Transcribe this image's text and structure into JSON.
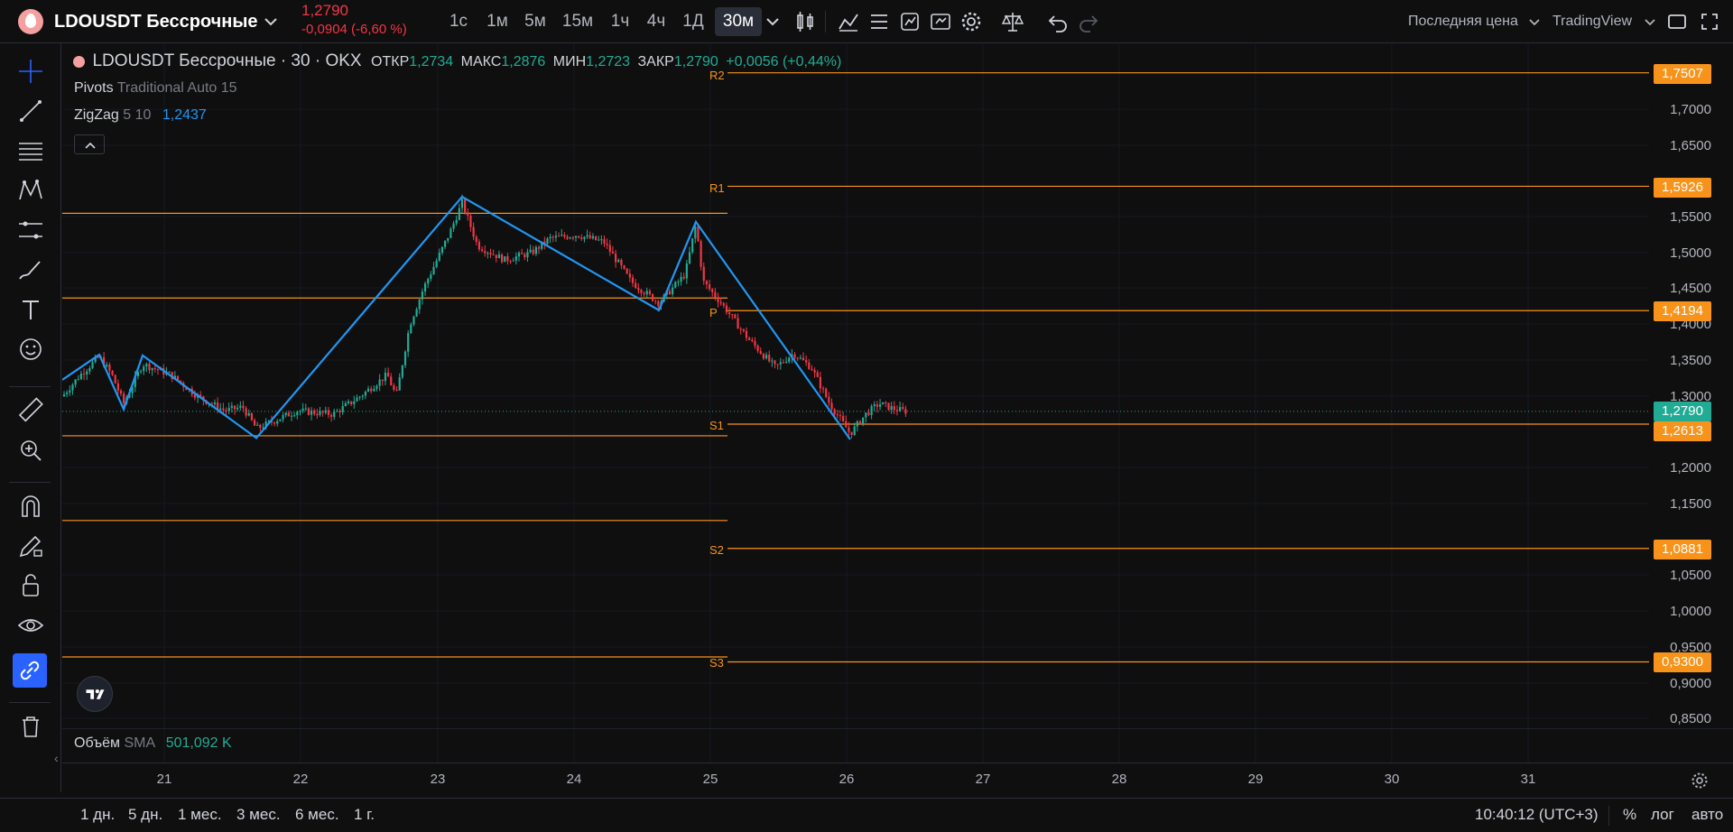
{
  "header": {
    "symbol": "LDOUSDT Бессрочные",
    "price": "1,2790",
    "change": "-0,0904 (-6,60 %)",
    "timeframes": [
      "1с",
      "1м",
      "5м",
      "15м",
      "1ч",
      "4ч",
      "1Д",
      "30м"
    ],
    "active_timeframe": "30м",
    "price_type": "Последняя цена",
    "chart_provider": "TradingView"
  },
  "legend": {
    "title": "LDOUSDT Бессрочные · 30 · OKX",
    "open_label": "ОТКР",
    "open": "1,2734",
    "high_label": "МАКС",
    "high": "1,2876",
    "low_label": "МИН",
    "low": "1,2723",
    "close_label": "ЗАКР",
    "close": "1,2790",
    "change": "+0,0056 (+0,44%)",
    "pivots_name": "Pivots",
    "pivots_params": "Traditional Auto 15",
    "zigzag_name": "ZigZag",
    "zigzag_params": "5 10",
    "zigzag_value": "1,2437",
    "volume_name": "Объём",
    "volume_sma": "SMA",
    "volume_value": "501,092 K"
  },
  "price_axis": {
    "ticks": [
      "1,7000",
      "1,6500",
      "1,5500",
      "1,5000",
      "1,4500",
      "1,4000",
      "1,3500",
      "1,3000",
      "1,2000",
      "1,1500",
      "1,0500",
      "1,0000",
      "0,9500",
      "0,9000",
      "0,8500"
    ],
    "labels": [
      {
        "text": "1,7507",
        "color": "#f7931a"
      },
      {
        "text": "1,5926",
        "color": "#f7931a"
      },
      {
        "text": "1,4194",
        "color": "#f7931a"
      },
      {
        "text": "1,2790",
        "color": "#22ab94"
      },
      {
        "text": "1,2613",
        "color": "#f7931a"
      },
      {
        "text": "1,0881",
        "color": "#f7931a"
      },
      {
        "text": "0,9300",
        "color": "#f7931a"
      }
    ]
  },
  "pivot_labels": [
    "R2",
    "R1",
    "P",
    "S1",
    "S2",
    "S3"
  ],
  "time_axis": [
    "21",
    "22",
    "23",
    "24",
    "25",
    "26",
    "27",
    "28",
    "29",
    "30",
    "31"
  ],
  "bottom": {
    "ranges": [
      "1 дн.",
      "5 дн.",
      "1 мес.",
      "3 мес.",
      "6 мес.",
      "1 г."
    ],
    "clock": "10:40:12 (UTC+3)",
    "percent": "%",
    "log": "лог",
    "auto": "авто"
  },
  "colors": {
    "accent": "#2962ff",
    "pivot": "#f7931a",
    "zigzag": "#2196f3",
    "up": "#22ab94",
    "down": "#f23645"
  },
  "icons": {
    "left": [
      "crosshair-icon",
      "trendline-icon",
      "fib-icon",
      "pattern-icon",
      "forecast-icon",
      "brush-icon",
      "text-icon",
      "emoji-icon",
      "ruler-icon",
      "zoom-icon",
      "magnet-icon",
      "lock-draw-icon",
      "lock-icon",
      "eye-icon",
      "link-icon",
      "trash-icon"
    ]
  }
}
